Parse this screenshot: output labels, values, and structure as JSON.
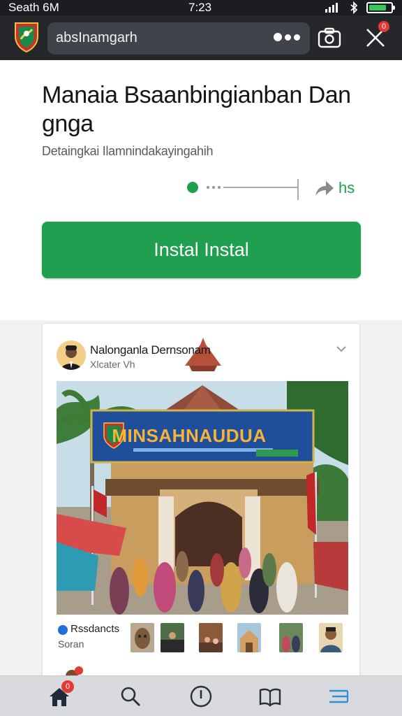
{
  "status_bar": {
    "carrier": "Seath 6M",
    "time": "7:23",
    "battery_percent": 80,
    "icons": [
      "signal-icon",
      "bluetooth-icon",
      "battery-icon"
    ]
  },
  "browser": {
    "logo_icon": "shield-logo-icon",
    "url": "absInamgarh",
    "more_icon": "more-dots-icon",
    "camera_icon": "camera-icon",
    "close_icon": "close-icon",
    "close_badge": "0"
  },
  "app": {
    "title": "Manaia Bsaanbingianban Dan gnga",
    "subtitle": "Detaingkai Ilamnindakayingahih",
    "share_label": "hs",
    "install_label": "Instal Instal",
    "accent_color": "#1f9f4f"
  },
  "post": {
    "author": "Nalonganla Dernsonam",
    "meta": "Xlcater Vh",
    "photo_banner_text": "MINSAHNAUDUA",
    "reactions_label": "Rssdancts",
    "reactions_sub": "Soran",
    "thumbnails": [
      "mask",
      "group",
      "room",
      "house",
      "crowd",
      "portrait"
    ]
  },
  "bottom_nav": {
    "items": [
      "home-icon",
      "search-icon",
      "compass-icon",
      "book-icon",
      "menu-icon"
    ],
    "home_badge": "0"
  }
}
